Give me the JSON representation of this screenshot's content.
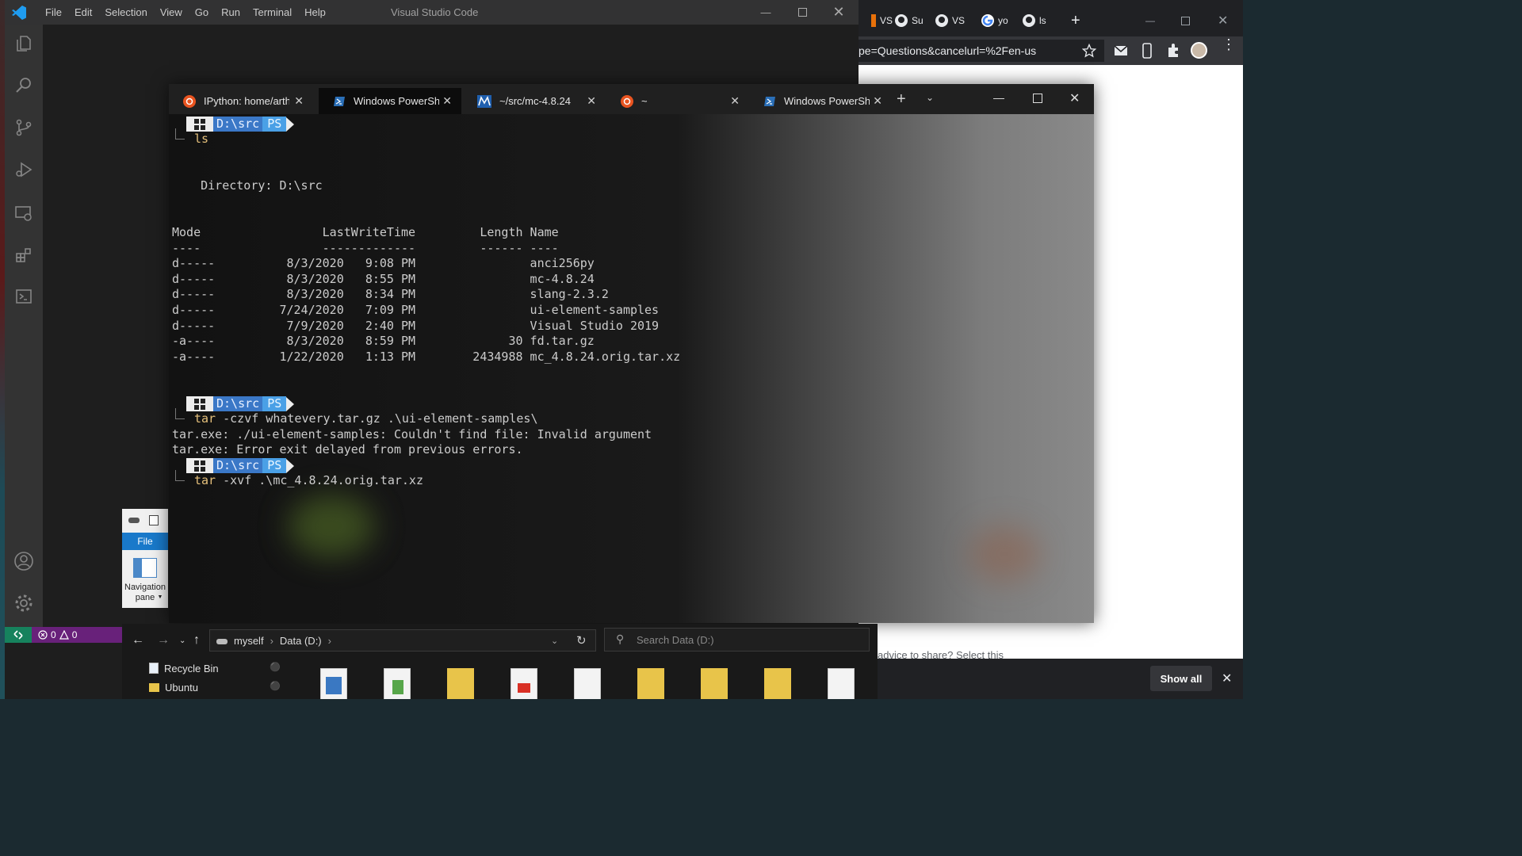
{
  "vscode": {
    "menu": [
      "File",
      "Edit",
      "Selection",
      "View",
      "Go",
      "Run",
      "Terminal",
      "Help"
    ],
    "title": "Visual Studio Code",
    "status": {
      "errors": "0",
      "warnings": "0"
    }
  },
  "chrome": {
    "tabs": [
      "VS",
      "Su",
      "VS",
      "yo",
      "ls"
    ],
    "url": "pe=Questions&cancelurl=%2Fen-us",
    "page_text": "advice to share? Select this",
    "show_all": "Show all"
  },
  "terminal": {
    "tabs": [
      {
        "label": "IPython: home/arthur",
        "icon": "ubuntu-icon"
      },
      {
        "label": "Windows PowerShell",
        "icon": "powershell-icon"
      },
      {
        "label": "~/src/mc-4.8.24",
        "icon": "mc-icon"
      },
      {
        "label": "~",
        "icon": "ubuntu-icon"
      },
      {
        "label": "Windows PowerShell",
        "icon": "powershell-icon"
      }
    ],
    "prompt": {
      "path": "D:\\src",
      "shell": "PS"
    },
    "cmd1": "ls",
    "dir_header": "    Directory: D:\\src",
    "col_header": "Mode                 LastWriteTime         Length Name",
    "col_rule": "----                 -------------         ------ ----",
    "rows": [
      "d-----          8/3/2020   9:08 PM                anci256py",
      "d-----          8/3/2020   8:55 PM                mc-4.8.24",
      "d-----          8/3/2020   8:34 PM                slang-2.3.2",
      "d-----         7/24/2020   7:09 PM                ui-element-samples",
      "d-----          7/9/2020   2:40 PM                Visual Studio 2019",
      "-a----          8/3/2020   8:59 PM             30 fd.tar.gz",
      "-a----         1/22/2020   1:13 PM        2434988 mc_4.8.24.orig.tar.xz"
    ],
    "cmd2_name": "tar",
    "cmd2_args": " -czvf whatevery.tar.gz .\\ui-element-samples\\",
    "err1": "tar.exe: ./ui-element-samples: Couldn't find file: Invalid argument",
    "err2": "tar.exe: Error exit delayed from previous errors.",
    "cmd3_name": "tar",
    "cmd3_args": " -xvf .\\mc_4.8.24.orig.tar.xz"
  },
  "explorer": {
    "file_tab": "File",
    "nav_pane": "Navigation pane",
    "breadcrumb": [
      "myself",
      "Data (D:)"
    ],
    "search_placeholder": "Search Data (D:)",
    "tree": [
      "Recycle Bin",
      "Ubuntu"
    ]
  },
  "colors": {
    "vscode_remote": "#16825d",
    "vscode_problems": "#68217a",
    "prompt_path": "#3b78c7",
    "prompt_ps": "#4aa0e6",
    "explorer_file_tab": "#1979ca"
  }
}
